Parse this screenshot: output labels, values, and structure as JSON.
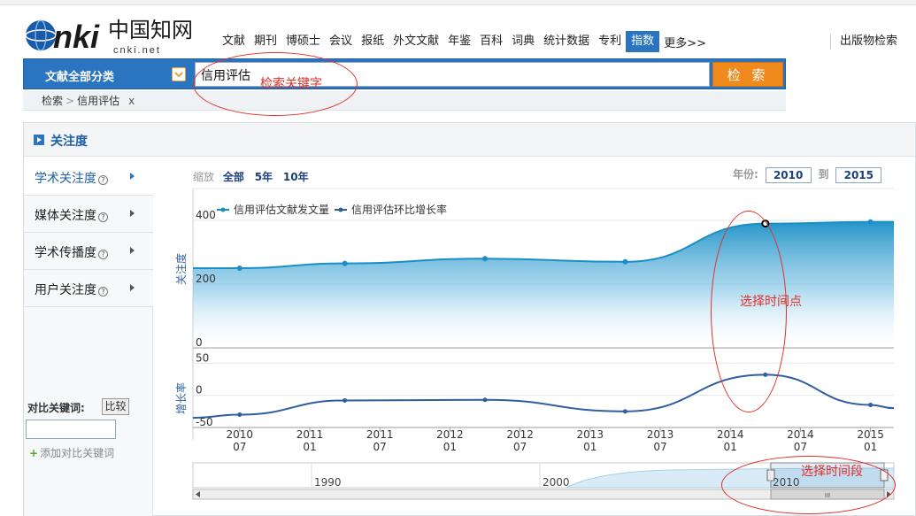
{
  "header": {
    "logo_text": "cnki.net",
    "nav": [
      "文献",
      "期刊",
      "博硕士",
      "会议",
      "报纸",
      "外文文献",
      "年鉴",
      "百科",
      "词典",
      "统计数据",
      "专利",
      "指数"
    ],
    "nav_active": "指数",
    "nav_more": "更多>>",
    "pub_search": "出版物检索"
  },
  "search": {
    "category": "文献全部分类",
    "value": "信用评估",
    "button": "检 索"
  },
  "breadcrumb": {
    "root": "检索",
    "current": "信用评估",
    "close": "x"
  },
  "annotations": {
    "keyword": "检索关键字",
    "point": "选择时间点",
    "range": "选择时间段"
  },
  "panel": {
    "title": "关注度",
    "side": [
      {
        "label": "学术关注度",
        "active": true
      },
      {
        "label": "媒体关注度",
        "active": false
      },
      {
        "label": "学术传播度",
        "active": false
      },
      {
        "label": "用户关注度",
        "active": false
      }
    ],
    "help_glyph": "?",
    "compare_label": "对比关键词:",
    "compare_button": "比较",
    "add_keyword": "添加对比关键词",
    "add_glyph": "+",
    "zoom_label": "缩放",
    "zoom_options": [
      "全部",
      "5年",
      "10年"
    ],
    "year_label": "年份:",
    "year_from": "2010",
    "year_to_label": "到",
    "year_to": "2015"
  },
  "colors": {
    "accent": "#2a74c0",
    "search_button": "#f08a1c",
    "series1": "#1b8fc5",
    "series2": "#2f5f9e",
    "annotation": "#e0302a"
  },
  "chart_data": {
    "type": "line",
    "x": [
      "2010-07",
      "2011-04",
      "2012-04",
      "2013-04",
      "2014-04",
      "2015-01"
    ],
    "series": [
      {
        "name": "信用评估文献发文量",
        "values": [
          250,
          265,
          280,
          270,
          390,
          395
        ]
      },
      {
        "name": "信用评估环比增长率",
        "values": [
          -30,
          -8,
          -7,
          -25,
          32,
          -15
        ]
      }
    ],
    "ylabel_top": "关注度",
    "ylabel_bottom": "增长率",
    "top_ticks": [
      "400",
      "200",
      "0"
    ],
    "bottom_ticks": [
      "50",
      "0",
      "-50"
    ],
    "x_ticks": [
      {
        "year": "2010",
        "month": "07"
      },
      {
        "year": "2011",
        "month": "01"
      },
      {
        "year": "2011",
        "month": "07"
      },
      {
        "year": "2012",
        "month": "01"
      },
      {
        "year": "2012",
        "month": "07"
      },
      {
        "year": "2013",
        "month": "01"
      },
      {
        "year": "2013",
        "month": "07"
      },
      {
        "year": "2014",
        "month": "01"
      },
      {
        "year": "2014",
        "month": "07"
      },
      {
        "year": "2015",
        "month": "01"
      }
    ],
    "navigator_labels": [
      "1990",
      "2000",
      "2010"
    ],
    "navigator_grip": "III",
    "top_ylim": [
      0,
      500
    ],
    "bottom_ylim": [
      -50,
      60
    ],
    "legend": "top-left",
    "grid": true
  }
}
